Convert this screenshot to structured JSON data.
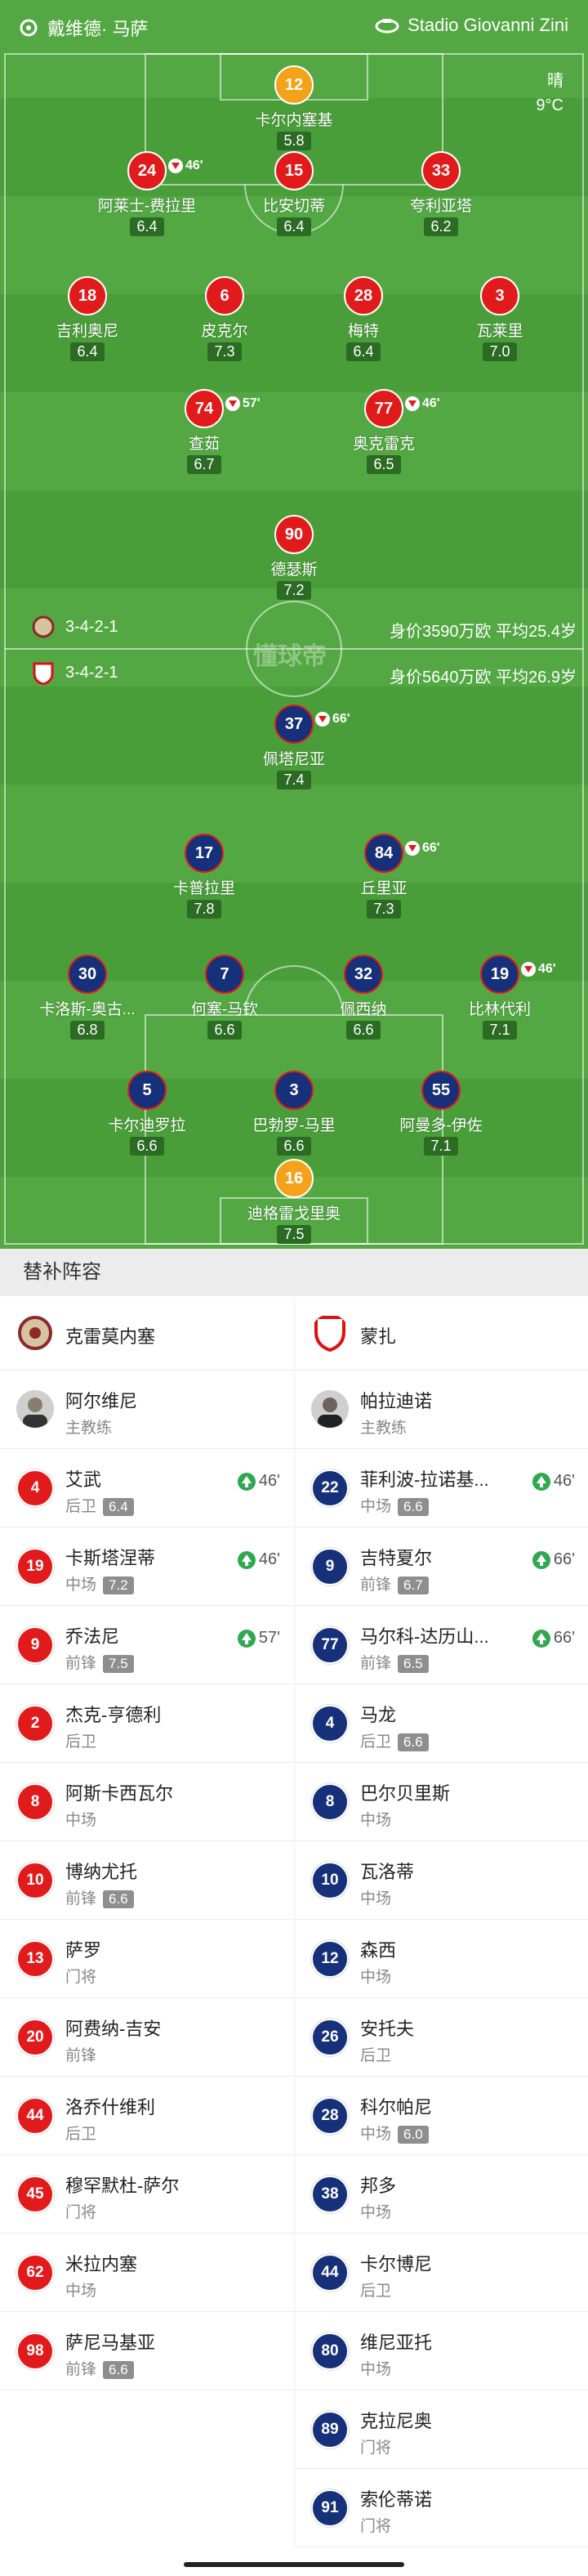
{
  "header": {
    "team_left": "戴维德· 马萨",
    "stadium": "Stadio Giovanni Zini"
  },
  "weather": {
    "condition": "晴",
    "temp": "9°C"
  },
  "teams": {
    "home": {
      "formation": "3-4-2-1",
      "value": "身价3590万欧",
      "avg_age": "平均25.4岁"
    },
    "away": {
      "formation": "3-4-2-1",
      "value": "身价5640万欧",
      "avg_age": "平均26.9岁"
    }
  },
  "watermark": "懂球帝",
  "pitch_players": [
    {
      "num": "12",
      "name": "卡尔内塞基",
      "rating": "5.8",
      "color": "gold",
      "extra": ""
    },
    {
      "num": "24",
      "name": "阿莱士-费拉里",
      "rating": "6.4",
      "color": "red",
      "extra": "46'"
    },
    {
      "num": "15",
      "name": "比安切蒂",
      "rating": "6.4",
      "color": "red",
      "extra": ""
    },
    {
      "num": "33",
      "name": "夸利亚塔",
      "rating": "6.2",
      "color": "red",
      "extra": ""
    },
    {
      "num": "18",
      "name": "吉利奥尼",
      "rating": "6.4",
      "color": "red",
      "extra": ""
    },
    {
      "num": "6",
      "name": "皮克尔",
      "rating": "7.3",
      "color": "red",
      "extra": ""
    },
    {
      "num": "28",
      "name": "梅特",
      "rating": "6.4",
      "color": "red",
      "extra": ""
    },
    {
      "num": "3",
      "name": "瓦莱里",
      "rating": "7.0",
      "color": "red",
      "extra": ""
    },
    {
      "num": "74",
      "name": "查茹",
      "rating": "6.7",
      "color": "red",
      "extra": "57'"
    },
    {
      "num": "77",
      "name": "奥克雷克",
      "rating": "6.5",
      "color": "red",
      "extra": "46'"
    },
    {
      "num": "90",
      "name": "德瑟斯",
      "rating": "7.2",
      "color": "red",
      "extra": ""
    },
    {
      "num": "37",
      "name": "佩塔尼亚",
      "rating": "7.4",
      "color": "blue",
      "extra": "66'"
    },
    {
      "num": "17",
      "name": "卡普拉里",
      "rating": "7.8",
      "color": "blue",
      "extra": ""
    },
    {
      "num": "84",
      "name": "丘里亚",
      "rating": "7.3",
      "color": "blue",
      "extra": "66'"
    },
    {
      "num": "30",
      "name": "卡洛斯-奥古...",
      "rating": "6.8",
      "color": "blue",
      "extra": ""
    },
    {
      "num": "7",
      "name": "何塞-马钦",
      "rating": "6.6",
      "color": "blue",
      "extra": ""
    },
    {
      "num": "32",
      "name": "佩西纳",
      "rating": "6.6",
      "color": "blue",
      "extra": ""
    },
    {
      "num": "19",
      "name": "比林代利",
      "rating": "7.1",
      "color": "blue",
      "extra": "46'"
    },
    {
      "num": "5",
      "name": "卡尔迪罗拉",
      "rating": "6.6",
      "color": "blue",
      "extra": ""
    },
    {
      "num": "3",
      "name": "巴勃罗-马里",
      "rating": "6.6",
      "color": "blue",
      "extra": ""
    },
    {
      "num": "55",
      "name": "阿曼多-伊佐",
      "rating": "7.1",
      "color": "blue",
      "extra": ""
    },
    {
      "num": "16",
      "name": "迪格雷戈里奥",
      "rating": "7.5",
      "color": "gold",
      "extra": ""
    }
  ],
  "subs_title": "替补阵容",
  "left_team": {
    "name": "克雷莫内塞",
    "coach": {
      "name": "阿尔维尼",
      "role": "主教练"
    },
    "subs": [
      {
        "num": "4",
        "name": "艾武",
        "pos": "后卫",
        "rating": "6.4",
        "minute": "46'"
      },
      {
        "num": "19",
        "name": "卡斯塔涅蒂",
        "pos": "中场",
        "rating": "7.2",
        "minute": "46'"
      },
      {
        "num": "9",
        "name": "乔法尼",
        "pos": "前锋",
        "rating": "7.5",
        "minute": "57'"
      },
      {
        "num": "2",
        "name": "杰克-亨德利",
        "pos": "后卫",
        "rating": "",
        "minute": ""
      },
      {
        "num": "8",
        "name": "阿斯卡西瓦尔",
        "pos": "中场",
        "rating": "",
        "minute": ""
      },
      {
        "num": "10",
        "name": "博纳尤托",
        "pos": "前锋",
        "rating": "6.6",
        "minute": ""
      },
      {
        "num": "13",
        "name": "萨罗",
        "pos": "门将",
        "rating": "",
        "minute": ""
      },
      {
        "num": "20",
        "name": "阿费纳-吉安",
        "pos": "前锋",
        "rating": "",
        "minute": ""
      },
      {
        "num": "44",
        "name": "洛乔什维利",
        "pos": "后卫",
        "rating": "",
        "minute": ""
      },
      {
        "num": "45",
        "name": "穆罕默杜-萨尔",
        "pos": "门将",
        "rating": "",
        "minute": ""
      },
      {
        "num": "62",
        "name": "米拉内塞",
        "pos": "中场",
        "rating": "",
        "minute": ""
      },
      {
        "num": "98",
        "name": "萨尼马基亚",
        "pos": "前锋",
        "rating": "6.6",
        "minute": ""
      }
    ]
  },
  "right_team": {
    "name": "蒙扎",
    "coach": {
      "name": "帕拉迪诺",
      "role": "主教练"
    },
    "subs": [
      {
        "num": "22",
        "name": "菲利波-拉诺基...",
        "pos": "中场",
        "rating": "6.6",
        "minute": "46'"
      },
      {
        "num": "9",
        "name": "吉特夏尔",
        "pos": "前锋",
        "rating": "6.7",
        "minute": "66'"
      },
      {
        "num": "77",
        "name": "马尔科-达历山...",
        "pos": "前锋",
        "rating": "6.5",
        "minute": "66'"
      },
      {
        "num": "4",
        "name": "马龙",
        "pos": "后卫",
        "rating": "6.6",
        "minute": ""
      },
      {
        "num": "8",
        "name": "巴尔贝里斯",
        "pos": "中场",
        "rating": "",
        "minute": ""
      },
      {
        "num": "10",
        "name": "瓦洛蒂",
        "pos": "中场",
        "rating": "",
        "minute": ""
      },
      {
        "num": "12",
        "name": "森西",
        "pos": "中场",
        "rating": "",
        "minute": ""
      },
      {
        "num": "26",
        "name": "安托夫",
        "pos": "后卫",
        "rating": "",
        "minute": ""
      },
      {
        "num": "28",
        "name": "科尔帕尼",
        "pos": "中场",
        "rating": "6.0",
        "minute": ""
      },
      {
        "num": "38",
        "name": "邦多",
        "pos": "中场",
        "rating": "",
        "minute": ""
      },
      {
        "num": "44",
        "name": "卡尔博尼",
        "pos": "后卫",
        "rating": "",
        "minute": ""
      },
      {
        "num": "80",
        "name": "维尼亚托",
        "pos": "中场",
        "rating": "",
        "minute": ""
      },
      {
        "num": "89",
        "name": "克拉尼奥",
        "pos": "门将",
        "rating": "",
        "minute": ""
      },
      {
        "num": "91",
        "name": "索伦蒂诺",
        "pos": "门将",
        "rating": "",
        "minute": ""
      }
    ]
  },
  "colors": {
    "pitch": "#4a9e3a",
    "home": "#e11b1b",
    "away": "#17307a",
    "keeper": "#f5a21b",
    "sub_in": "#2fa84f"
  }
}
